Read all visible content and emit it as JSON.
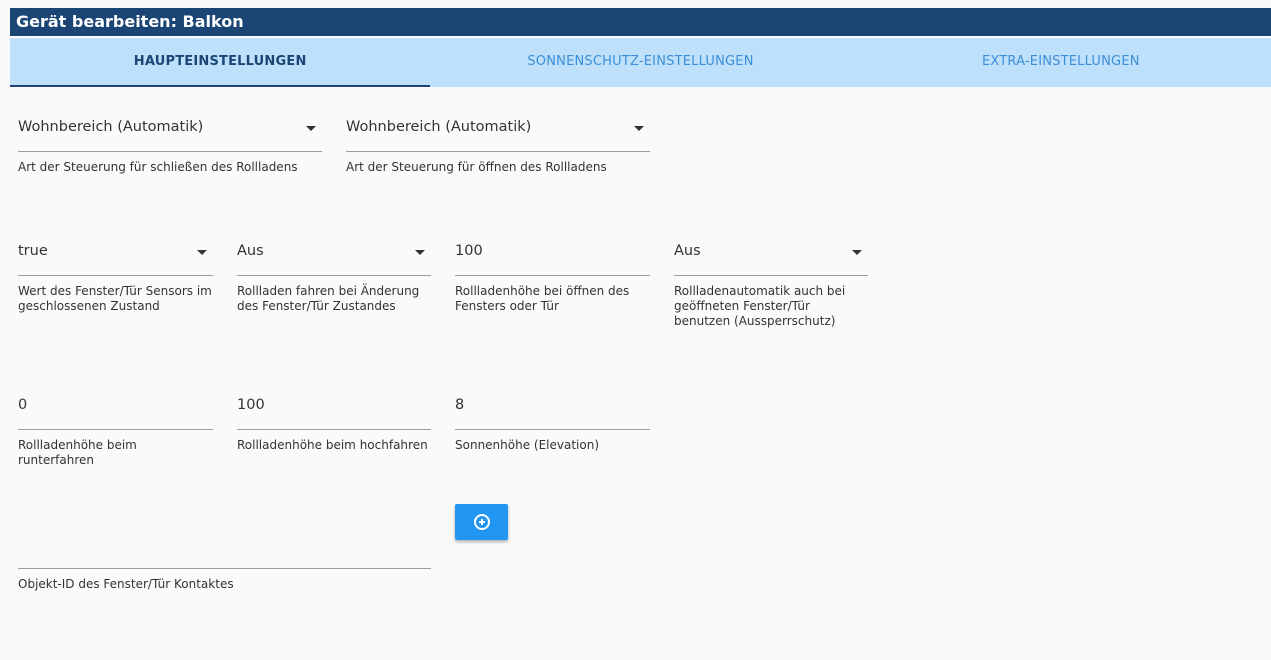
{
  "dialog": {
    "title": "Gerät bearbeiten: Balkon"
  },
  "tabs": [
    {
      "label": "HAUPTEINSTELLUNGEN",
      "active": true
    },
    {
      "label": "SONNENSCHUTZ-EINSTELLUNGEN",
      "active": false
    },
    {
      "label": "EXTRA-EINSTELLUNGEN",
      "active": false
    }
  ],
  "row1": {
    "close_control": {
      "value": "Wohnbereich (Automatik)",
      "helper": "Art der Steuerung für schließen des Rollladens"
    },
    "open_control": {
      "value": "Wohnbereich (Automatik)",
      "helper": "Art der Steuerung für öffnen des Rollladens"
    }
  },
  "row2": {
    "sensor_value": {
      "value": "true",
      "helper": "Wert des Fenster/Tür Sensors im geschlossenen Zustand"
    },
    "move_on_change": {
      "value": "Aus",
      "helper": "Rollladen fahren bei Änderung des Fenster/Tür Zustandes"
    },
    "height_on_open": {
      "value": "100",
      "helper": "Rollladenhöhe bei öffnen des Fensters oder Tür"
    },
    "lockout": {
      "value": "Aus",
      "helper": "Rollladenautomatik auch bei geöffneten Fenster/Tür benutzen (Aussperrschutz)"
    }
  },
  "row3": {
    "height_down": {
      "value": "0",
      "helper": "Rollladenhöhe beim runterfahren"
    },
    "height_up": {
      "value": "100",
      "helper": "Rollladenhöhe beim hochfahren"
    },
    "elevation": {
      "value": "8",
      "helper": "Sonnenhöhe (Elevation)"
    }
  },
  "contact": {
    "value": "",
    "helper": "Objekt-ID des Fenster/Tür Kontaktes"
  },
  "colors": {
    "header": "#1a4574",
    "tabbar": "#bfe0fa",
    "tab_inactive": "#3b8fd8",
    "button": "#2196f3"
  },
  "icons": {
    "add_button": "add-circle-icon"
  }
}
